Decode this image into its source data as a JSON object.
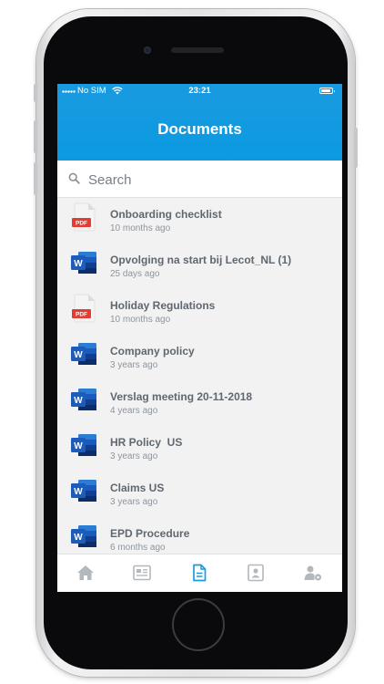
{
  "status_bar": {
    "carrier": "No SIM",
    "time": "23:21"
  },
  "header": {
    "title": "Documents"
  },
  "search": {
    "placeholder": "Search",
    "value": ""
  },
  "documents": [
    {
      "name": "Onboarding checklist",
      "date": "10 months ago",
      "type": "pdf",
      "type_label": "PDF"
    },
    {
      "name": "Opvolging na start bij Lecot_NL (1)",
      "date": "25 days ago",
      "type": "word",
      "type_label": "W"
    },
    {
      "name": "Holiday Regulations",
      "date": "10 months ago",
      "type": "pdf",
      "type_label": "PDF"
    },
    {
      "name": "Company policy",
      "date": "3 years ago",
      "type": "word",
      "type_label": "W"
    },
    {
      "name": "Verslag meeting 20-11-2018",
      "date": "4 years ago",
      "type": "word",
      "type_label": "W"
    },
    {
      "name": "HR Policy  US",
      "date": "3 years ago",
      "type": "word",
      "type_label": "W"
    },
    {
      "name": "Claims US",
      "date": "3 years ago",
      "type": "word",
      "type_label": "W"
    },
    {
      "name": "EPD Procedure",
      "date": "6 months ago",
      "type": "word",
      "type_label": "W"
    }
  ],
  "tabbar": {
    "tabs": [
      {
        "icon": "home-icon",
        "active": false
      },
      {
        "icon": "news-icon",
        "active": false
      },
      {
        "icon": "document-icon",
        "active": true
      },
      {
        "icon": "contact-card-icon",
        "active": false
      },
      {
        "icon": "user-settings-icon",
        "active": false
      }
    ]
  },
  "colors": {
    "header_blue": "#0b9ae1",
    "active_tab": "#1a9ae0",
    "inactive_tab": "#b3b8bd",
    "pdf_red": "#e53b30",
    "word_blue": "#1f5bb8"
  }
}
